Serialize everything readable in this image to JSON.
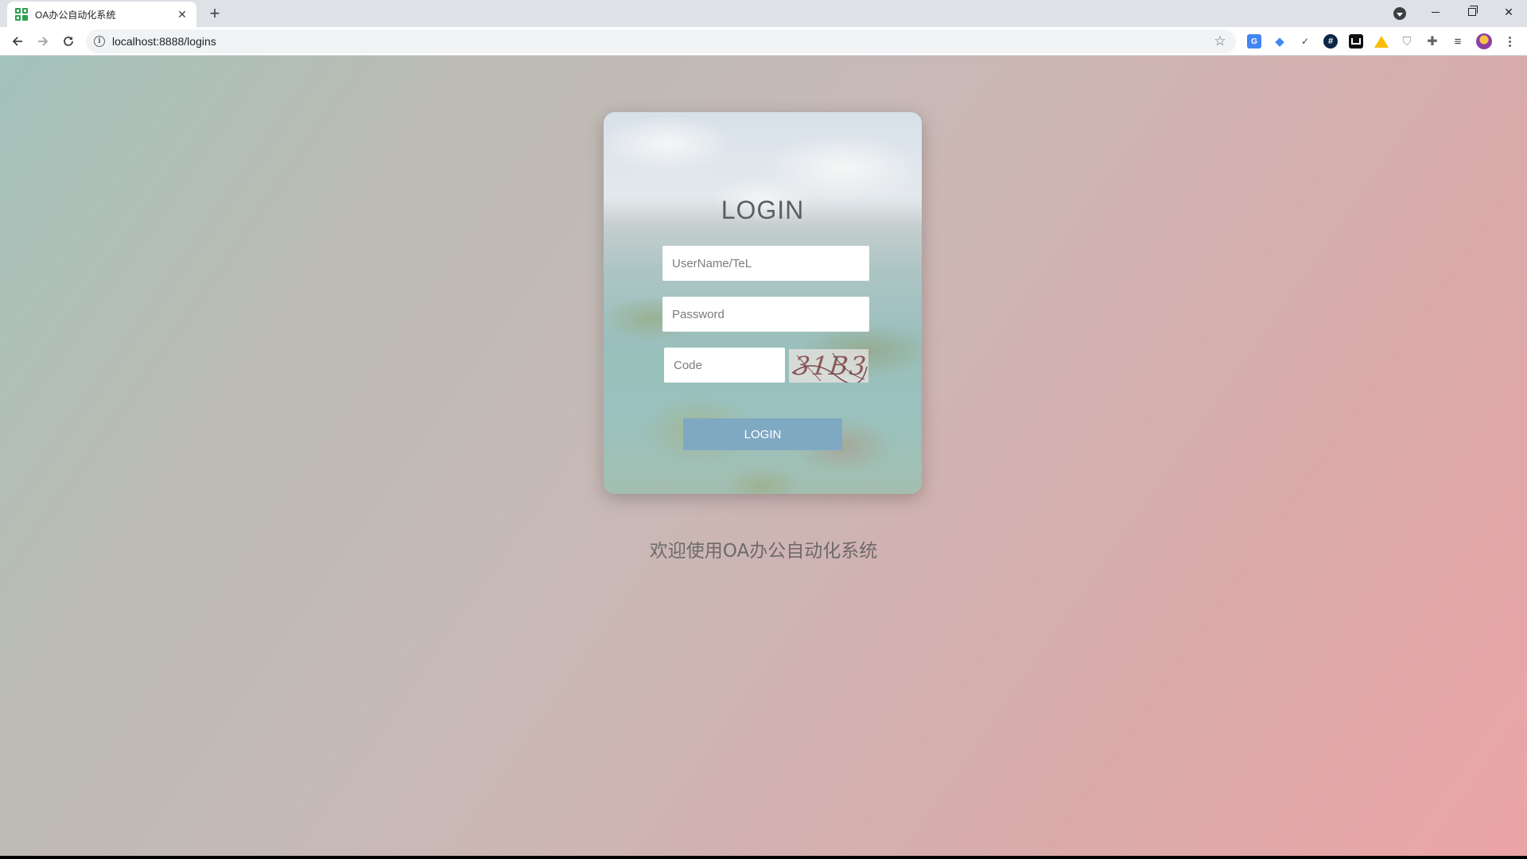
{
  "browser": {
    "tab": {
      "title": "OA办公自动化系统",
      "close_glyph": "✕"
    },
    "new_tab_glyph": "+",
    "url": "localhost:8888/logins",
    "bookmark_glyph": "☆",
    "icons": [
      "back-arrow-icon",
      "forward-arrow-icon",
      "reload-icon",
      "info-icon",
      "star-icon",
      "google-translate-icon",
      "graduation-cap-icon",
      "check-icon",
      "hashtag-icon",
      "book-icon",
      "google-drive-icon",
      "shield-icon",
      "puzzle-icon",
      "reading-list-icon",
      "avatar",
      "menu-dots-icon"
    ]
  },
  "login": {
    "title": "LOGIN",
    "username_placeholder": "UserName/TeL",
    "password_placeholder": "Password",
    "code_placeholder": "Code",
    "captcha_text": "31B3",
    "button_label": "LOGIN"
  },
  "footer": {
    "welcome": "欢迎使用OA办公自动化系统"
  },
  "colors": {
    "button": "#7fa9c2",
    "title": "#5a6062",
    "gradient_start": "#a3c3bb",
    "gradient_end": "#eba4a6"
  }
}
